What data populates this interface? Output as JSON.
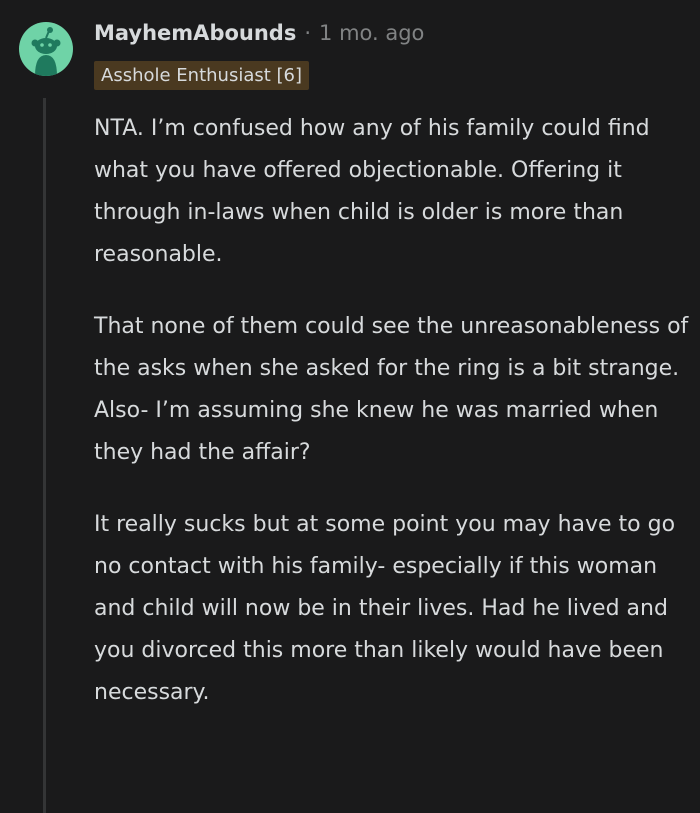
{
  "comment": {
    "username": "MayhemAbounds",
    "separator": "·",
    "timestamp": "1 mo. ago",
    "flair": "Asshole Enthusiast [6]",
    "paragraphs": [
      "NTA. I’m confused how any of his family could find what you have offered objectionable. Offering it through in-laws when child is older is more than reasonable.",
      "That none of them could see the unreasonableness of the asks when she asked for the ring is a bit strange. Also- I’m assuming she knew he was married when they had the affair?",
      "It really sucks but at some point you may have to go no contact with his family- especially if this woman and child will now be in their lives. Had he lived and you divorced this more than likely would have been necessary."
    ]
  },
  "colors": {
    "background": "#1a1a1b",
    "avatar_bg": "#6fd3a7",
    "avatar_figure": "#1f7a5e",
    "flair_bg": "#4a3920",
    "text": "#d7dadc",
    "meta": "#818384",
    "thread_line": "#343536"
  },
  "icons": {
    "avatar": "reddit-snoo-avatar-icon"
  }
}
